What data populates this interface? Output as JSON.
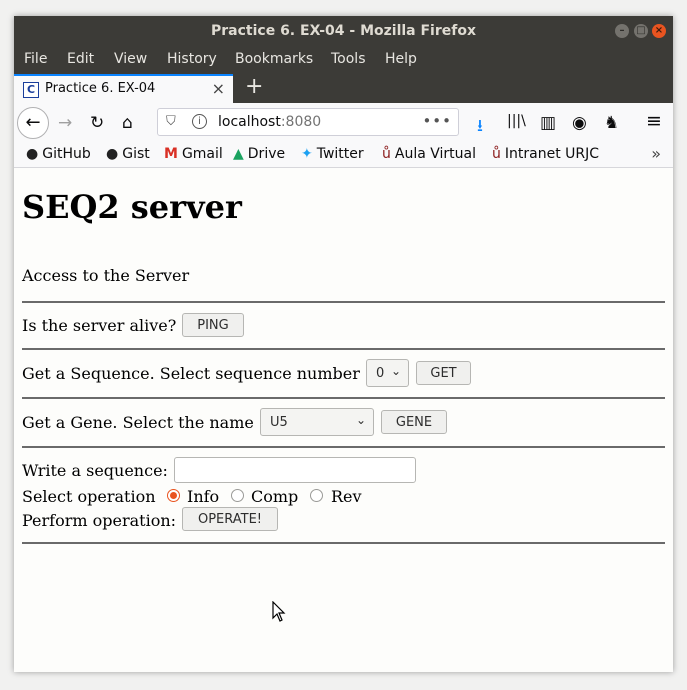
{
  "window": {
    "title": "Practice 6. EX-04 - Mozilla Firefox",
    "controls": {
      "minimize": "–",
      "maximize": "□",
      "close": "×"
    }
  },
  "menu": [
    "File",
    "Edit",
    "View",
    "History",
    "Bookmarks",
    "Tools",
    "Help"
  ],
  "tab": {
    "favicon_letter": "C",
    "title": "Practice 6. EX-04",
    "close": "×",
    "new_tab": "+"
  },
  "nav": {
    "back": "←",
    "forward": "→",
    "reload": "↻",
    "home": "⌂",
    "url_host": "localhost",
    "url_port": ":8080",
    "url_more": "•••",
    "download": "⭳",
    "library": "|||\\",
    "sidebar": "▥",
    "account": "◉",
    "extension": "♞",
    "menu": "≡"
  },
  "bookmarks": [
    {
      "label": "GitHub",
      "icon": "github-icon",
      "glyph": "●"
    },
    {
      "label": "Gist",
      "icon": "github-icon",
      "glyph": "●"
    },
    {
      "label": "Gmail",
      "icon": "gmail-icon",
      "glyph": "M"
    },
    {
      "label": "Drive",
      "icon": "drive-icon",
      "glyph": "▲"
    },
    {
      "label": "Twitter",
      "icon": "twitter-icon",
      "glyph": "✦"
    },
    {
      "label": "Aula Virtual",
      "icon": "urjc-icon",
      "glyph": "ů"
    },
    {
      "label": "Intranet URJC",
      "icon": "urjc-icon",
      "glyph": "ů"
    }
  ],
  "bookmarks_more": "»",
  "page": {
    "heading": "SEQ2 server",
    "intro": "Access to the Server",
    "ping": {
      "label": "Is the server alive?",
      "button": "PING"
    },
    "get": {
      "label": "Get a Sequence. Select sequence number",
      "selected": "0",
      "button": "GET"
    },
    "gene": {
      "label": "Get a Gene. Select the name",
      "selected": "U5",
      "button": "GENE"
    },
    "operate": {
      "write_label": "Write a sequence:",
      "input_value": "",
      "select_label": "Select operation",
      "options": [
        "Info",
        "Comp",
        "Rev"
      ],
      "selected_option": "Info",
      "perform_label": "Perform operation:",
      "button": "OPERATE!"
    }
  },
  "colors": {
    "accent": "#e95420",
    "titlebar": "#3c3b37",
    "tab_highlight": "#0a84ff"
  }
}
